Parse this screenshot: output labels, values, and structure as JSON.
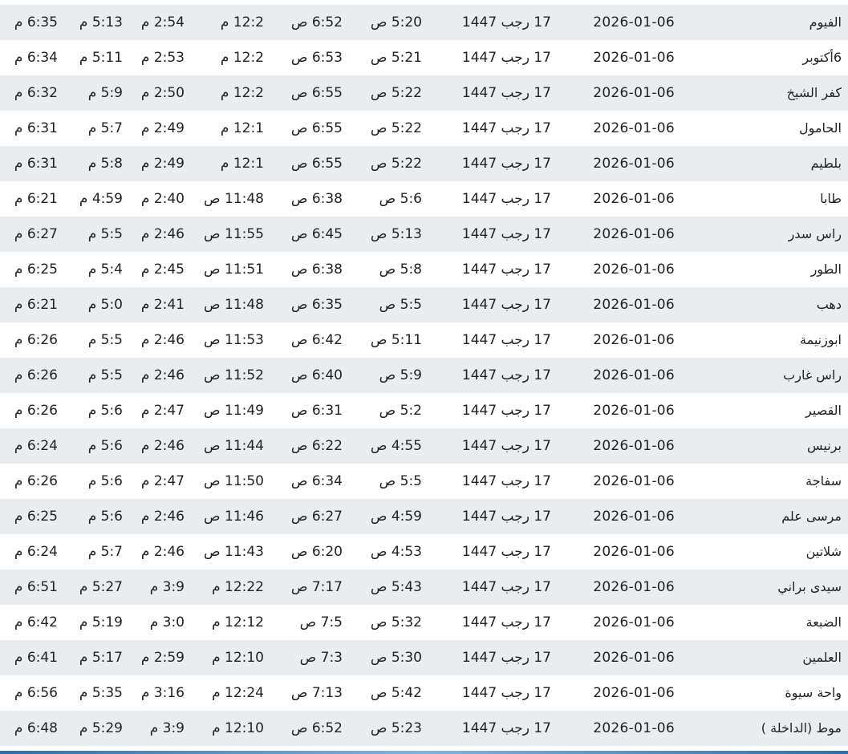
{
  "rows": [
    {
      "city": "الفيوم",
      "date": "2026-01-06",
      "hijri": "17 رجب 1447",
      "fajr": "5:20 ص",
      "sunrise": "6:52 ص",
      "dhuhr": "12:2 م",
      "asr": "2:54 م",
      "maghrib": "5:13 م",
      "isha": "6:35 م"
    },
    {
      "city": "6أكتوبر",
      "date": "2026-01-06",
      "hijri": "17 رجب 1447",
      "fajr": "5:21 ص",
      "sunrise": "6:53 ص",
      "dhuhr": "12:2 م",
      "asr": "2:53 م",
      "maghrib": "5:11 م",
      "isha": "6:34 م"
    },
    {
      "city": "كفر الشيخ",
      "date": "2026-01-06",
      "hijri": "17 رجب 1447",
      "fajr": "5:22 ص",
      "sunrise": "6:55 ص",
      "dhuhr": "12:2 م",
      "asr": "2:50 م",
      "maghrib": "5:9 م",
      "isha": "6:32 م"
    },
    {
      "city": "الحامول",
      "date": "2026-01-06",
      "hijri": "17 رجب 1447",
      "fajr": "5:22 ص",
      "sunrise": "6:55 ص",
      "dhuhr": "12:1 م",
      "asr": "2:49 م",
      "maghrib": "5:7 م",
      "isha": "6:31 م"
    },
    {
      "city": "بلطيم",
      "date": "2026-01-06",
      "hijri": "17 رجب 1447",
      "fajr": "5:22 ص",
      "sunrise": "6:55 ص",
      "dhuhr": "12:1 م",
      "asr": "2:49 م",
      "maghrib": "5:8 م",
      "isha": "6:31 م"
    },
    {
      "city": "طابا",
      "date": "2026-01-06",
      "hijri": "17 رجب 1447",
      "fajr": "5:6 ص",
      "sunrise": "6:38 ص",
      "dhuhr": "11:48 ص",
      "asr": "2:40 م",
      "maghrib": "4:59 م",
      "isha": "6:21 م"
    },
    {
      "city": "راس سدر",
      "date": "2026-01-06",
      "hijri": "17 رجب 1447",
      "fajr": "5:13 ص",
      "sunrise": "6:45 ص",
      "dhuhr": "11:55 ص",
      "asr": "2:46 م",
      "maghrib": "5:5 م",
      "isha": "6:27 م"
    },
    {
      "city": "الطور",
      "date": "2026-01-06",
      "hijri": "17 رجب 1447",
      "fajr": "5:8 ص",
      "sunrise": "6:38 ص",
      "dhuhr": "11:51 ص",
      "asr": "2:45 م",
      "maghrib": "5:4 م",
      "isha": "6:25 م"
    },
    {
      "city": "دهب",
      "date": "2026-01-06",
      "hijri": "17 رجب 1447",
      "fajr": "5:5 ص",
      "sunrise": "6:35 ص",
      "dhuhr": "11:48 ص",
      "asr": "2:41 م",
      "maghrib": "5:0 م",
      "isha": "6:21 م"
    },
    {
      "city": "ابوزنيمة",
      "date": "2026-01-06",
      "hijri": "17 رجب 1447",
      "fajr": "5:11 ص",
      "sunrise": "6:42 ص",
      "dhuhr": "11:53 ص",
      "asr": "2:46 م",
      "maghrib": "5:5 م",
      "isha": "6:26 م"
    },
    {
      "city": "راس غارب",
      "date": "2026-01-06",
      "hijri": "17 رجب 1447",
      "fajr": "5:9 ص",
      "sunrise": "6:40 ص",
      "dhuhr": "11:52 ص",
      "asr": "2:46 م",
      "maghrib": "5:5 م",
      "isha": "6:26 م"
    },
    {
      "city": "القصير",
      "date": "2026-01-06",
      "hijri": "17 رجب 1447",
      "fajr": "5:2 ص",
      "sunrise": "6:31 ص",
      "dhuhr": "11:49 ص",
      "asr": "2:47 م",
      "maghrib": "5:6 م",
      "isha": "6:26 م"
    },
    {
      "city": "برنيس",
      "date": "2026-01-06",
      "hijri": "17 رجب 1447",
      "fajr": "4:55 ص",
      "sunrise": "6:22 ص",
      "dhuhr": "11:44 ص",
      "asr": "2:46 م",
      "maghrib": "5:6 م",
      "isha": "6:24 م"
    },
    {
      "city": "سفاجة",
      "date": "2026-01-06",
      "hijri": "17 رجب 1447",
      "fajr": "5:5 ص",
      "sunrise": "6:34 ص",
      "dhuhr": "11:50 ص",
      "asr": "2:47 م",
      "maghrib": "5:6 م",
      "isha": "6:26 م"
    },
    {
      "city": "مرسى علم",
      "date": "2026-01-06",
      "hijri": "17 رجب 1447",
      "fajr": "4:59 ص",
      "sunrise": "6:27 ص",
      "dhuhr": "11:46 ص",
      "asr": "2:46 م",
      "maghrib": "5:6 م",
      "isha": "6:25 م"
    },
    {
      "city": "شلاتين",
      "date": "2026-01-06",
      "hijri": "17 رجب 1447",
      "fajr": "4:53 ص",
      "sunrise": "6:20 ص",
      "dhuhr": "11:43 ص",
      "asr": "2:46 م",
      "maghrib": "5:7 م",
      "isha": "6:24 م"
    },
    {
      "city": "سيدى براني",
      "date": "2026-01-06",
      "hijri": "17 رجب 1447",
      "fajr": "5:43 ص",
      "sunrise": "7:17 ص",
      "dhuhr": "12:22 م",
      "asr": "3:9 م",
      "maghrib": "5:27 م",
      "isha": "6:51 م"
    },
    {
      "city": "الضبعة",
      "date": "2026-01-06",
      "hijri": "17 رجب 1447",
      "fajr": "5:32 ص",
      "sunrise": "7:5 ص",
      "dhuhr": "12:12 م",
      "asr": "3:0 م",
      "maghrib": "5:19 م",
      "isha": "6:42 م"
    },
    {
      "city": "العلمين",
      "date": "2026-01-06",
      "hijri": "17 رجب 1447",
      "fajr": "5:30 ص",
      "sunrise": "7:3 ص",
      "dhuhr": "12:10 م",
      "asr": "2:59 م",
      "maghrib": "5:17 م",
      "isha": "6:41 م"
    },
    {
      "city": "واحة سيوة",
      "date": "2026-01-06",
      "hijri": "17 رجب 1447",
      "fajr": "5:42 ص",
      "sunrise": "7:13 ص",
      "dhuhr": "12:24 م",
      "asr": "3:16 م",
      "maghrib": "5:35 م",
      "isha": "6:56 م"
    },
    {
      "city": "موط (الداخلة )",
      "date": "2026-01-06",
      "hijri": "17 رجب 1447",
      "fajr": "5:23 ص",
      "sunrise": "6:52 ص",
      "dhuhr": "12:10 م",
      "asr": "3:9 م",
      "maghrib": "5:29 م",
      "isha": "6:48 م"
    }
  ]
}
